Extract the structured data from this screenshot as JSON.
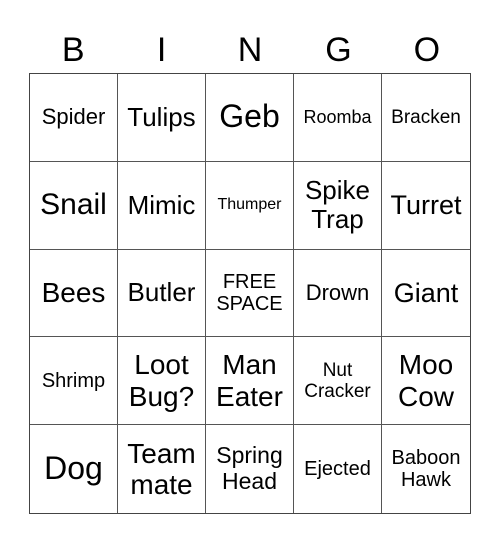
{
  "header": {
    "letters": [
      "B",
      "I",
      "N",
      "G",
      "O"
    ]
  },
  "cells": [
    [
      "Spider",
      "Tulips",
      "Geb",
      "Roomba",
      "Bracken"
    ],
    [
      "Snail",
      "Mimic",
      "Thumper",
      "Spike Trap",
      "Turret"
    ],
    [
      "Bees",
      "Butler",
      "FREE SPACE",
      "Drown",
      "Giant"
    ],
    [
      "Shrimp",
      "Loot Bug?",
      "Man Eater",
      "Nut Cracker",
      "Moo Cow"
    ],
    [
      "Dog",
      "Team mate",
      "Spring Head",
      "Ejected",
      "Baboon Hawk"
    ]
  ]
}
